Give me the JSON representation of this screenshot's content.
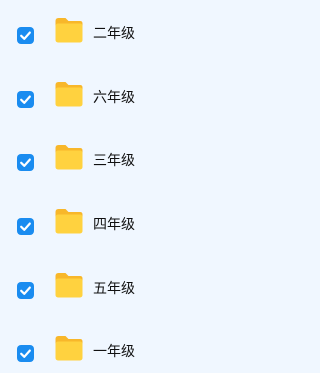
{
  "folders": [
    {
      "name": "二年级",
      "checked": true
    },
    {
      "name": "六年级",
      "checked": true
    },
    {
      "name": "三年级",
      "checked": true
    },
    {
      "name": "四年级",
      "checked": true
    },
    {
      "name": "五年级",
      "checked": true
    },
    {
      "name": "一年级",
      "checked": true
    }
  ],
  "icons": {
    "checkbox": "checkbox-checked-icon",
    "folder": "folder-icon"
  },
  "colors": {
    "background": "#f0f7ff",
    "checkbox": "#1a8cf0",
    "folder_front": "#ffd23f",
    "folder_back": "#f8b72a"
  }
}
